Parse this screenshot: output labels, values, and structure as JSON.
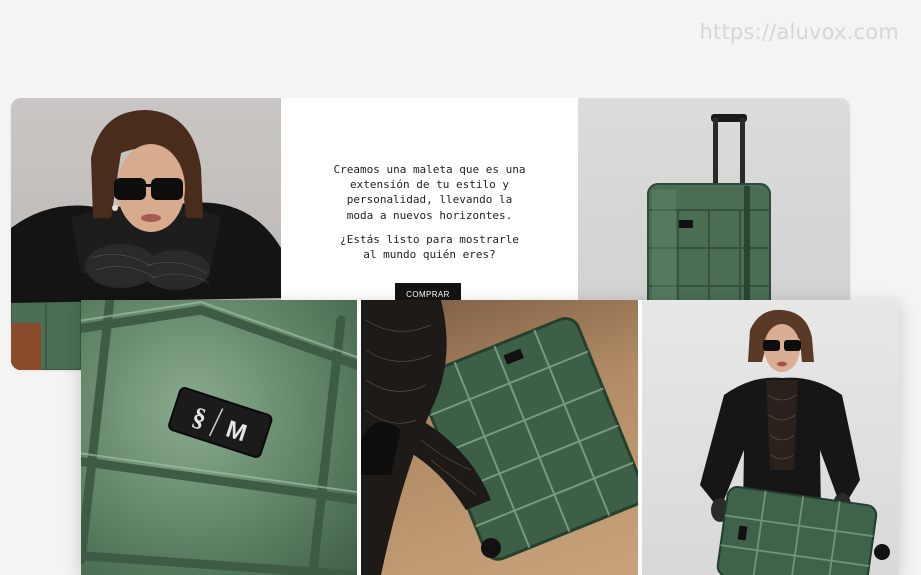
{
  "watermark": "https://aluvox.com",
  "promo": {
    "paragraph1": "Creamos una maleta que es una\nextensión de tu estilo y\npersonalidad, llevando la\nmoda a nuevos horizontes.",
    "paragraph2": "¿Estás listo para mostrarle\nal mundo quién eres?",
    "cta_label": "COMPRAR"
  },
  "badge_text": "M",
  "colors": {
    "suitcase_green": "#4f7259",
    "cta_background": "#141414",
    "page_background": "#f4f4f4"
  }
}
